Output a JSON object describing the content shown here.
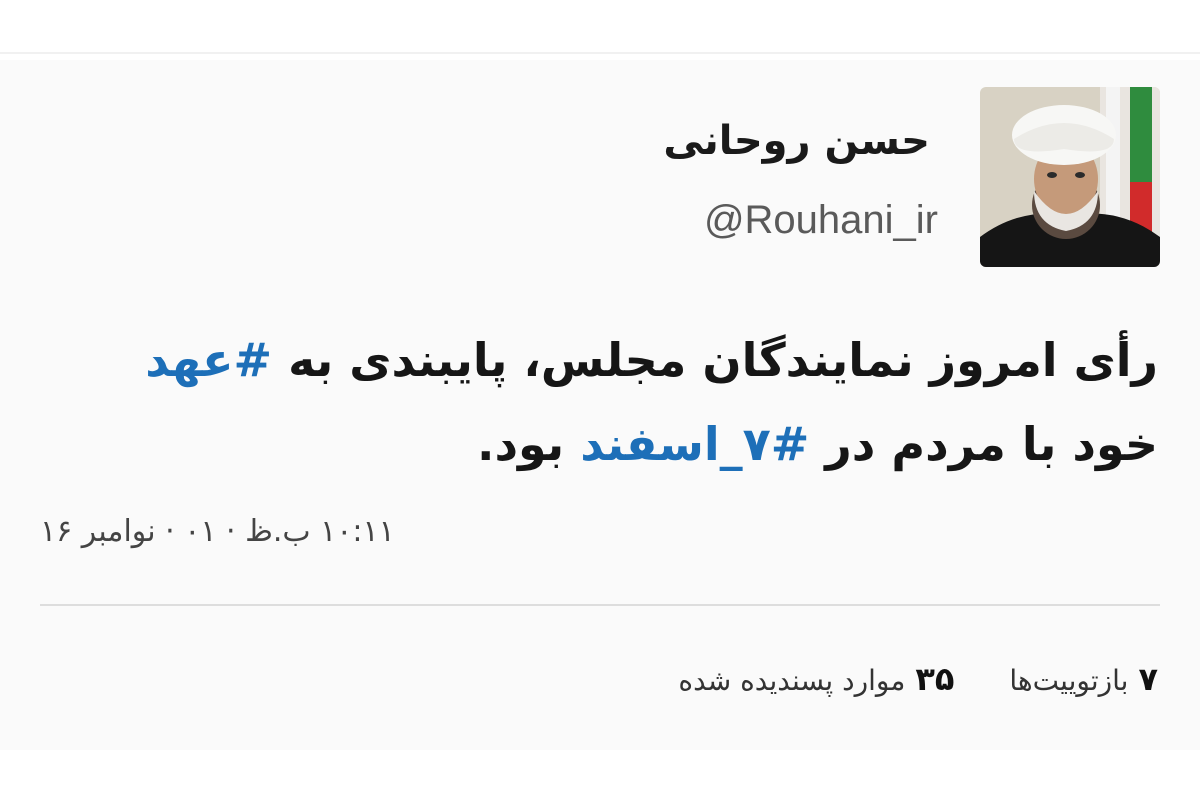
{
  "tweet": {
    "author": {
      "name": "حسن روحانی",
      "handle": "@Rouhani_ir",
      "avatar_icon": "profile-photo"
    },
    "text": {
      "part1": "رأی امروز نمایندگان مجلس، پایبندی به ",
      "hashtag1": "#عهد",
      "part2": " خود با مردم در ",
      "hashtag2": "#۷_اسفند",
      "part3": " بود."
    },
    "timestamp": "۱۰:۱۱ ب.ظ · ۰۱ · نوامبر ۱۶",
    "stats": {
      "retweets_count": "۷",
      "retweets_label": "بازتوییت‌ها",
      "likes_count": "۳۵",
      "likes_label": "موارد پسندیده شده"
    },
    "colors": {
      "hashtag": "#1d6fb8",
      "text": "#161616",
      "background": "#fafafa"
    }
  }
}
